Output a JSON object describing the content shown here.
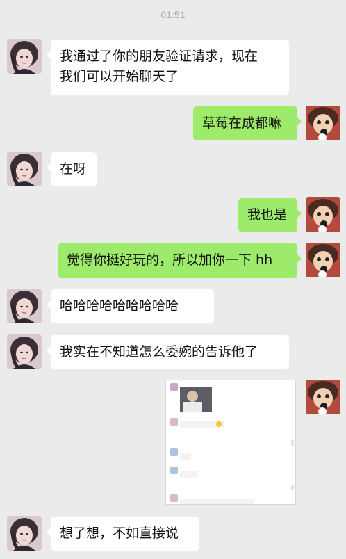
{
  "chat": {
    "timestamp": "01:51",
    "messages": [
      {
        "side": "in",
        "lines": [
          "我通过了你的朋友验证请求，现在",
          "我们可以开始聊天了"
        ]
      },
      {
        "side": "out",
        "lines": [
          "草莓在成都嘛"
        ]
      },
      {
        "side": "in",
        "lines": [
          "在呀"
        ]
      },
      {
        "side": "out",
        "lines": [
          "我也是"
        ]
      },
      {
        "side": "out",
        "lines": [
          "觉得你挺好玩的，所以加你一下 hh"
        ]
      },
      {
        "side": "in",
        "lines": [
          "哈哈哈哈哈哈哈哈哈"
        ]
      },
      {
        "side": "in",
        "lines": [
          "我实在不知道怎么委婉的告诉他了"
        ]
      },
      {
        "side": "out",
        "type": "image",
        "description_icon": "screenshot-image"
      },
      {
        "side": "in",
        "lines": [
          "想了想，不如直接说"
        ]
      }
    ]
  },
  "colors": {
    "background": "#ebebeb",
    "incoming_bubble": "#ffffff",
    "outgoing_bubble": "#9eea6a",
    "timestamp": "#a9a9a9"
  }
}
